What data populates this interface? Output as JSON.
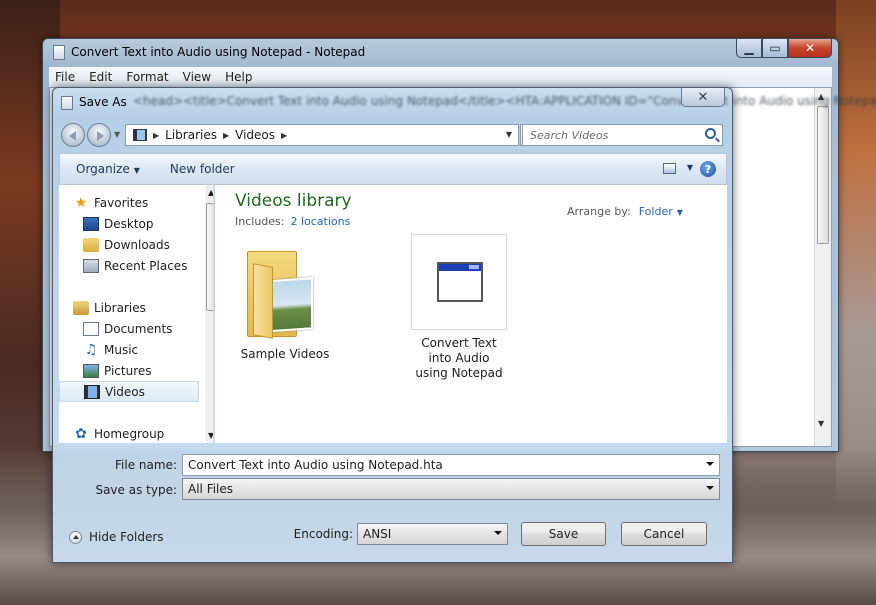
{
  "notepad": {
    "title": "Convert Text into Audio using Notepad - Notepad",
    "menu": [
      "File",
      "Edit",
      "Format",
      "View",
      "Help"
    ],
    "background_text": "<head><title>Convert Text into Audio using Notepad</title><HTA:APPLICATION ID=\"Convert Text into Audio using Notepad\""
  },
  "dialog": {
    "title": "Save As",
    "address": {
      "crumbs": [
        "Libraries",
        "Videos"
      ]
    },
    "search_placeholder": "Search Videos",
    "toolbar": {
      "organize": "Organize",
      "new_folder": "New folder"
    },
    "nav": {
      "favorites": "Favorites",
      "favorites_items": [
        "Desktop",
        "Downloads",
        "Recent Places"
      ],
      "libraries": "Libraries",
      "libraries_items": [
        "Documents",
        "Music",
        "Pictures",
        "Videos"
      ],
      "selected": "Videos",
      "homegroup": "Homegroup"
    },
    "content": {
      "title": "Videos library",
      "includes_label": "Includes:",
      "includes_link": "2 locations",
      "arrange_label": "Arrange by:",
      "arrange_value": "Folder",
      "items": [
        {
          "label": "Sample Videos",
          "icon": "folder-icon"
        },
        {
          "label": "Convert Text into Audio using Notepad",
          "icon": "hta-file-icon"
        }
      ]
    },
    "file_name_label": "File name:",
    "file_name_value": "Convert Text into Audio using Notepad.hta",
    "save_type_label": "Save as type:",
    "save_type_value": "All Files",
    "hide_folders": "Hide Folders",
    "encoding_label": "Encoding:",
    "encoding_value": "ANSI",
    "save_button": "Save",
    "cancel_button": "Cancel"
  }
}
